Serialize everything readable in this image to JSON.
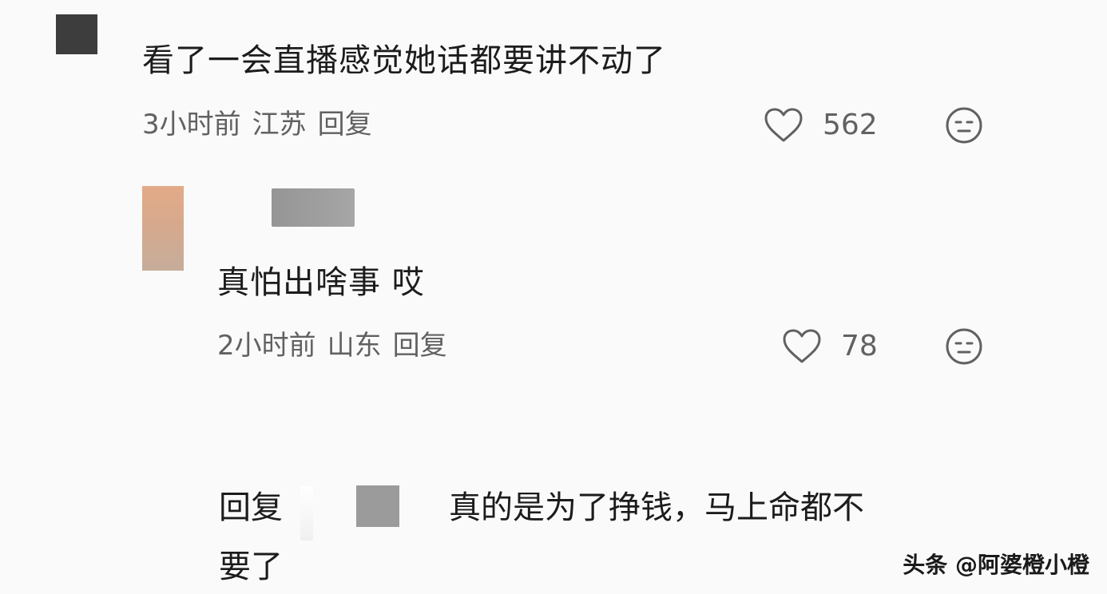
{
  "comments": [
    {
      "text": "看了一会直播感觉她话都要讲不动了",
      "time": "3小时前",
      "location": "江苏",
      "reply_label": "回复",
      "likes": "562"
    },
    {
      "text": "真怕出啥事  哎",
      "time": "2小时前",
      "location": "山东",
      "reply_label": "回复",
      "likes": "78"
    }
  ],
  "nested_reply": {
    "prefix": "回复",
    "text_line1": "真的是为了挣钱，马上命都不",
    "text_line2": "要了"
  },
  "watermark": "头条 @阿婆橙小橙",
  "colors": {
    "background": "#fafafa",
    "text": "#1c1c1c",
    "meta": "#616161"
  },
  "icons": [
    "heart-icon",
    "face-icon"
  ]
}
